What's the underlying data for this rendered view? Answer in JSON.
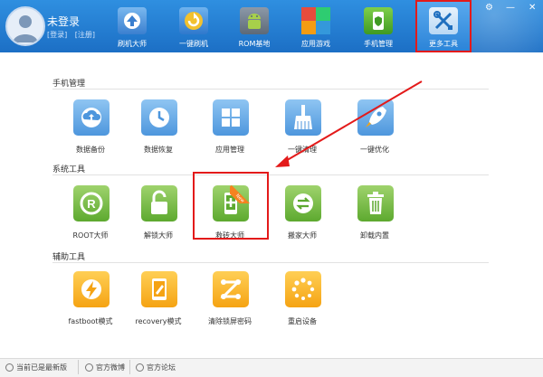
{
  "header": {
    "user_name": "未登录",
    "login_link": "[登录]",
    "register_link": "[注册]",
    "nav": [
      {
        "label": "刷机大师",
        "icon": "phone-flash-icon"
      },
      {
        "label": "一键刷机",
        "icon": "refresh-icon"
      },
      {
        "label": "ROM基地",
        "icon": "android-robot-icon"
      },
      {
        "label": "应用游戏",
        "icon": "app-grid-icon"
      },
      {
        "label": "手机管理",
        "icon": "phone-shield-icon"
      },
      {
        "label": "更多工具",
        "icon": "tools-icon"
      }
    ],
    "window_controls": {
      "settings": "⚙",
      "minimize": "—",
      "close": "✕"
    },
    "colors": {
      "header_top": "#2f8fe0",
      "header_bottom": "#1c6fc5",
      "highlight": "#e31a1a"
    }
  },
  "sections": [
    {
      "title": "手机管理",
      "tiles": [
        {
          "label": "数据备份",
          "icon": "cloud-upload-icon",
          "color": "blue"
        },
        {
          "label": "数据恢复",
          "icon": "clock-icon",
          "color": "blue"
        },
        {
          "label": "应用管理",
          "icon": "grid-icon",
          "color": "blue"
        },
        {
          "label": "一键清理",
          "icon": "broom-icon",
          "color": "blue"
        },
        {
          "label": "一键优化",
          "icon": "rocket-icon",
          "color": "blue"
        }
      ]
    },
    {
      "title": "系统工具",
      "tiles": [
        {
          "label": "ROOT大师",
          "icon": "root-icon",
          "color": "green"
        },
        {
          "label": "解锁大师",
          "icon": "unlock-icon",
          "color": "green"
        },
        {
          "label": "救砖大师",
          "icon": "phone-rescue-icon",
          "color": "green",
          "badge": "New"
        },
        {
          "label": "搬家大师",
          "icon": "transfer-icon",
          "color": "green"
        },
        {
          "label": "卸载内置",
          "icon": "trash-icon",
          "color": "green"
        }
      ]
    },
    {
      "title": "辅助工具",
      "tiles": [
        {
          "label": "fastboot模式",
          "icon": "lightning-icon",
          "color": "orange"
        },
        {
          "label": "recovery模式",
          "icon": "tablet-edit-icon",
          "color": "orange"
        },
        {
          "label": "清除锁屏密码",
          "icon": "pattern-lock-icon",
          "color": "orange"
        },
        {
          "label": "重启设备",
          "icon": "loading-spinner-icon",
          "color": "orange"
        }
      ]
    }
  ],
  "footer": {
    "status": "当前已是最新版",
    "weibo": "官方微博",
    "forum": "官方论坛"
  }
}
